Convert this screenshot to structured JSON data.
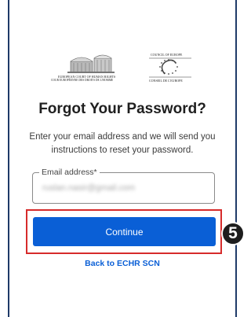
{
  "logos": {
    "echr_line1": "EUROPEAN COURT OF HUMAN RIGHTS",
    "echr_line2": "COUR EUROPÉENNE DES DROITS DE L'HOMME",
    "coe_line1": "COUNCIL OF EUROPE",
    "coe_line2": "CONSEIL DE L'EUROPE"
  },
  "page": {
    "title": "Forgot Your Password?",
    "description": "Enter your email address and we will send you instructions to reset your password."
  },
  "email_field": {
    "label": "Email address*",
    "value": "ruslan.nasir@gmail.com"
  },
  "actions": {
    "continue_label": "Continue",
    "back_link_label": "Back to ECHR SCN"
  },
  "annotation": {
    "step_number": "5"
  },
  "colors": {
    "primary_button": "#0a5fd6",
    "link": "#0a5fd6",
    "highlight": "#d62b2b",
    "frame": "#1f3a68"
  }
}
